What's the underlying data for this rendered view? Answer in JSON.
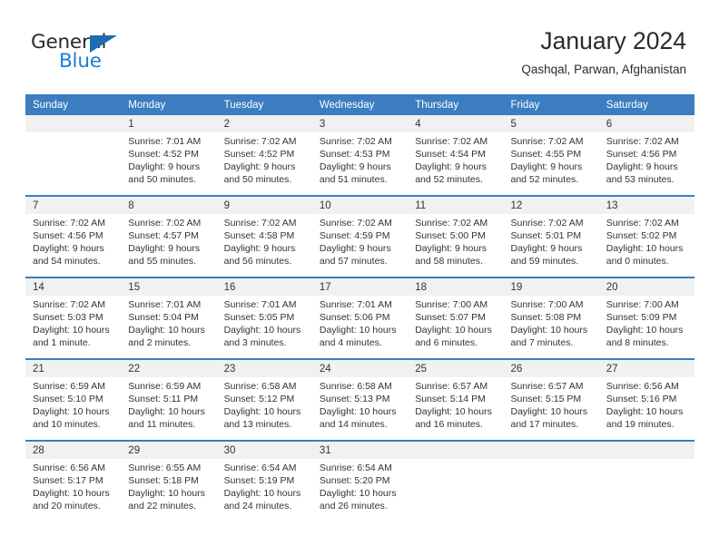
{
  "brand": {
    "word1": "General",
    "word2": "Blue",
    "accent_color": "#1b7fd4",
    "triangle_color": "#1d6cb5"
  },
  "header": {
    "title": "January 2024",
    "location": "Qashqal, Parwan, Afghanistan"
  },
  "calendar": {
    "header_bg": "#3b7dc0",
    "daynum_bg": "#f1f1f1",
    "weekdays": [
      "Sunday",
      "Monday",
      "Tuesday",
      "Wednesday",
      "Thursday",
      "Friday",
      "Saturday"
    ],
    "weeks": [
      [
        {
          "day": "",
          "lines": []
        },
        {
          "day": "1",
          "lines": [
            "Sunrise: 7:01 AM",
            "Sunset: 4:52 PM",
            "Daylight: 9 hours",
            "and 50 minutes."
          ]
        },
        {
          "day": "2",
          "lines": [
            "Sunrise: 7:02 AM",
            "Sunset: 4:52 PM",
            "Daylight: 9 hours",
            "and 50 minutes."
          ]
        },
        {
          "day": "3",
          "lines": [
            "Sunrise: 7:02 AM",
            "Sunset: 4:53 PM",
            "Daylight: 9 hours",
            "and 51 minutes."
          ]
        },
        {
          "day": "4",
          "lines": [
            "Sunrise: 7:02 AM",
            "Sunset: 4:54 PM",
            "Daylight: 9 hours",
            "and 52 minutes."
          ]
        },
        {
          "day": "5",
          "lines": [
            "Sunrise: 7:02 AM",
            "Sunset: 4:55 PM",
            "Daylight: 9 hours",
            "and 52 minutes."
          ]
        },
        {
          "day": "6",
          "lines": [
            "Sunrise: 7:02 AM",
            "Sunset: 4:56 PM",
            "Daylight: 9 hours",
            "and 53 minutes."
          ]
        }
      ],
      [
        {
          "day": "7",
          "lines": [
            "Sunrise: 7:02 AM",
            "Sunset: 4:56 PM",
            "Daylight: 9 hours",
            "and 54 minutes."
          ]
        },
        {
          "day": "8",
          "lines": [
            "Sunrise: 7:02 AM",
            "Sunset: 4:57 PM",
            "Daylight: 9 hours",
            "and 55 minutes."
          ]
        },
        {
          "day": "9",
          "lines": [
            "Sunrise: 7:02 AM",
            "Sunset: 4:58 PM",
            "Daylight: 9 hours",
            "and 56 minutes."
          ]
        },
        {
          "day": "10",
          "lines": [
            "Sunrise: 7:02 AM",
            "Sunset: 4:59 PM",
            "Daylight: 9 hours",
            "and 57 minutes."
          ]
        },
        {
          "day": "11",
          "lines": [
            "Sunrise: 7:02 AM",
            "Sunset: 5:00 PM",
            "Daylight: 9 hours",
            "and 58 minutes."
          ]
        },
        {
          "day": "12",
          "lines": [
            "Sunrise: 7:02 AM",
            "Sunset: 5:01 PM",
            "Daylight: 9 hours",
            "and 59 minutes."
          ]
        },
        {
          "day": "13",
          "lines": [
            "Sunrise: 7:02 AM",
            "Sunset: 5:02 PM",
            "Daylight: 10 hours",
            "and 0 minutes."
          ]
        }
      ],
      [
        {
          "day": "14",
          "lines": [
            "Sunrise: 7:02 AM",
            "Sunset: 5:03 PM",
            "Daylight: 10 hours",
            "and 1 minute."
          ]
        },
        {
          "day": "15",
          "lines": [
            "Sunrise: 7:01 AM",
            "Sunset: 5:04 PM",
            "Daylight: 10 hours",
            "and 2 minutes."
          ]
        },
        {
          "day": "16",
          "lines": [
            "Sunrise: 7:01 AM",
            "Sunset: 5:05 PM",
            "Daylight: 10 hours",
            "and 3 minutes."
          ]
        },
        {
          "day": "17",
          "lines": [
            "Sunrise: 7:01 AM",
            "Sunset: 5:06 PM",
            "Daylight: 10 hours",
            "and 4 minutes."
          ]
        },
        {
          "day": "18",
          "lines": [
            "Sunrise: 7:00 AM",
            "Sunset: 5:07 PM",
            "Daylight: 10 hours",
            "and 6 minutes."
          ]
        },
        {
          "day": "19",
          "lines": [
            "Sunrise: 7:00 AM",
            "Sunset: 5:08 PM",
            "Daylight: 10 hours",
            "and 7 minutes."
          ]
        },
        {
          "day": "20",
          "lines": [
            "Sunrise: 7:00 AM",
            "Sunset: 5:09 PM",
            "Daylight: 10 hours",
            "and 8 minutes."
          ]
        }
      ],
      [
        {
          "day": "21",
          "lines": [
            "Sunrise: 6:59 AM",
            "Sunset: 5:10 PM",
            "Daylight: 10 hours",
            "and 10 minutes."
          ]
        },
        {
          "day": "22",
          "lines": [
            "Sunrise: 6:59 AM",
            "Sunset: 5:11 PM",
            "Daylight: 10 hours",
            "and 11 minutes."
          ]
        },
        {
          "day": "23",
          "lines": [
            "Sunrise: 6:58 AM",
            "Sunset: 5:12 PM",
            "Daylight: 10 hours",
            "and 13 minutes."
          ]
        },
        {
          "day": "24",
          "lines": [
            "Sunrise: 6:58 AM",
            "Sunset: 5:13 PM",
            "Daylight: 10 hours",
            "and 14 minutes."
          ]
        },
        {
          "day": "25",
          "lines": [
            "Sunrise: 6:57 AM",
            "Sunset: 5:14 PM",
            "Daylight: 10 hours",
            "and 16 minutes."
          ]
        },
        {
          "day": "26",
          "lines": [
            "Sunrise: 6:57 AM",
            "Sunset: 5:15 PM",
            "Daylight: 10 hours",
            "and 17 minutes."
          ]
        },
        {
          "day": "27",
          "lines": [
            "Sunrise: 6:56 AM",
            "Sunset: 5:16 PM",
            "Daylight: 10 hours",
            "and 19 minutes."
          ]
        }
      ],
      [
        {
          "day": "28",
          "lines": [
            "Sunrise: 6:56 AM",
            "Sunset: 5:17 PM",
            "Daylight: 10 hours",
            "and 20 minutes."
          ]
        },
        {
          "day": "29",
          "lines": [
            "Sunrise: 6:55 AM",
            "Sunset: 5:18 PM",
            "Daylight: 10 hours",
            "and 22 minutes."
          ]
        },
        {
          "day": "30",
          "lines": [
            "Sunrise: 6:54 AM",
            "Sunset: 5:19 PM",
            "Daylight: 10 hours",
            "and 24 minutes."
          ]
        },
        {
          "day": "31",
          "lines": [
            "Sunrise: 6:54 AM",
            "Sunset: 5:20 PM",
            "Daylight: 10 hours",
            "and 26 minutes."
          ]
        },
        {
          "day": "",
          "lines": []
        },
        {
          "day": "",
          "lines": []
        },
        {
          "day": "",
          "lines": []
        }
      ]
    ]
  }
}
